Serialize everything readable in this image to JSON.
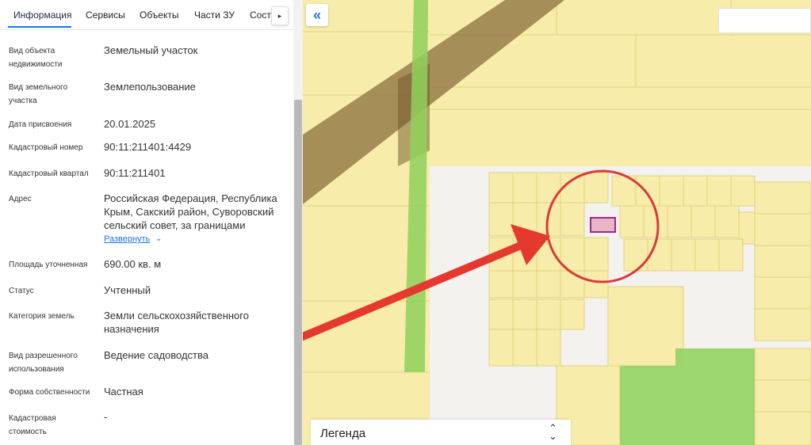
{
  "tabs": [
    {
      "label": "Информация"
    },
    {
      "label": "Сервисы"
    },
    {
      "label": "Объекты"
    },
    {
      "label": "Части ЗУ"
    },
    {
      "label": "Соста"
    }
  ],
  "info": {
    "object_type": {
      "label": "Вид объекта недвижимости",
      "value": "Земельный участок"
    },
    "plot_type": {
      "label": "Вид земельного участка",
      "value": "Землепользование"
    },
    "date_assigned": {
      "label": "Дата присвоения",
      "value": "20.01.2025"
    },
    "cadastral_number": {
      "label": "Кадастровый номер",
      "value": "90:11:211401:4429"
    },
    "cadastral_quarter": {
      "label": "Кадастровый квартал",
      "value": "90:11:211401"
    },
    "address": {
      "label": "Адрес",
      "value": "Российская Федерация, Республика Крым, Сакский район, Суворовский сельский совет, за границами",
      "expand": "Развернуть"
    },
    "area": {
      "label": "Площадь уточненная",
      "value": "690.00 кв. м"
    },
    "status": {
      "label": "Статус",
      "value": "Учтенный"
    },
    "land_category": {
      "label": "Категория земель",
      "value": "Земли сельскохозяйственного назначения"
    },
    "permitted_use": {
      "label": "Вид разрешенного использования",
      "value": "Ведение садоводства"
    },
    "ownership": {
      "label": "Форма собственности",
      "value": "Частная"
    },
    "cadastral_value": {
      "label": "Кадастровая стоимость",
      "value": "-"
    }
  },
  "map": {
    "legend_label": "Легенда",
    "colors": {
      "parcel_fill": "#f7ecaa",
      "parcel_stroke": "#e3d27c",
      "road": "#f3f2ef",
      "green_strip": "#8fd15c",
      "brown_band": "#8b6f3e",
      "selected_parcel": "#e7b5c4",
      "selected_stroke": "#9c2a8a",
      "circle": "#d83a3a",
      "arrow": "#e5392f",
      "green_field": "#92d45f"
    }
  },
  "icons": {
    "collapse": "double-chevron-left-icon",
    "tab_scroll": "chevron-right-icon",
    "expand": "chevron-down-icon",
    "legend_toggle": "chevron-up-down-icon"
  }
}
